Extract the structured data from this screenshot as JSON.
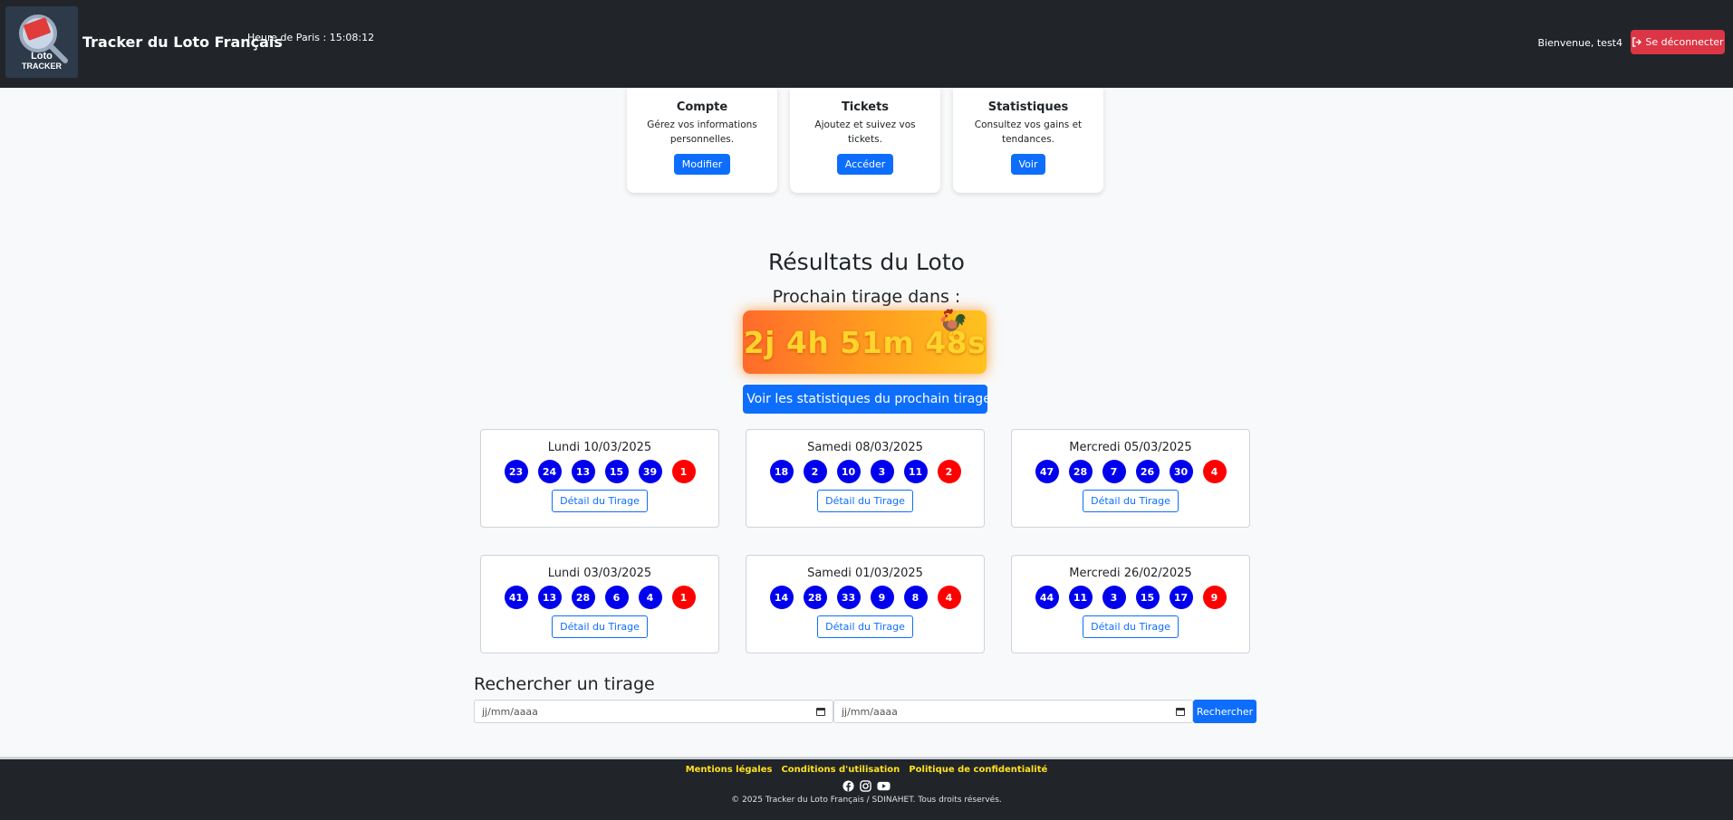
{
  "header": {
    "logo_text_1": "Loto",
    "logo_text_2": "TRACKER",
    "site_title": "Tracker du Loto Français",
    "clock": "Heure de Paris : 15:08:12",
    "welcome": "Bienvenue, test4",
    "logout_label": "Se déconnecter"
  },
  "cards": [
    {
      "title": "Compte",
      "text": "Gérez vos informations personnelles.",
      "button": "Modifier"
    },
    {
      "title": "Tickets",
      "text": "Ajoutez et suivez vos tickets.",
      "button": "Accéder"
    },
    {
      "title": "Statistiques",
      "text": "Consultez vos gains et tendances.",
      "button": "Voir"
    }
  ],
  "results": {
    "title": "Résultats du Loto",
    "next_draw_label": "Prochain tirage dans :",
    "countdown": "2j 4h 51m 48s",
    "stats_button": "Voir les statistiques du prochain tirage"
  },
  "draws": [
    {
      "date": "Lundi 10/03/2025",
      "numbers": [
        "23",
        "24",
        "13",
        "15",
        "39"
      ],
      "lucky": "1"
    },
    {
      "date": "Samedi 08/03/2025",
      "numbers": [
        "18",
        "2",
        "10",
        "3",
        "11"
      ],
      "lucky": "2"
    },
    {
      "date": "Mercredi 05/03/2025",
      "numbers": [
        "47",
        "28",
        "7",
        "26",
        "30"
      ],
      "lucky": "4"
    },
    {
      "date": "Lundi 03/03/2025",
      "numbers": [
        "41",
        "13",
        "28",
        "6",
        "4"
      ],
      "lucky": "1"
    },
    {
      "date": "Samedi 01/03/2025",
      "numbers": [
        "14",
        "28",
        "33",
        "9",
        "8"
      ],
      "lucky": "4"
    },
    {
      "date": "Mercredi 26/02/2025",
      "numbers": [
        "44",
        "11",
        "3",
        "15",
        "17"
      ],
      "lucky": "9"
    }
  ],
  "detail_label": "Détail du Tirage",
  "search": {
    "title": "Rechercher un tirage",
    "date_placeholder_1": "jj/mm/aaaa",
    "date_placeholder_2": "jj/mm/aaaa",
    "button": "Rechercher"
  },
  "footer": {
    "links": [
      "Mentions légales",
      "Conditions d'utilisation",
      "Politique de confidentialité"
    ],
    "copyright": "© 2025 Tracker du Loto Français / SDINAHET. Tous droits réservés."
  },
  "colors": {
    "header_bg": "#212529",
    "primary": "#0d6efd",
    "danger": "#dc3545",
    "ball_main": "#0000ee",
    "ball_lucky": "#ff0000",
    "footer_link": "#ffe11f"
  }
}
